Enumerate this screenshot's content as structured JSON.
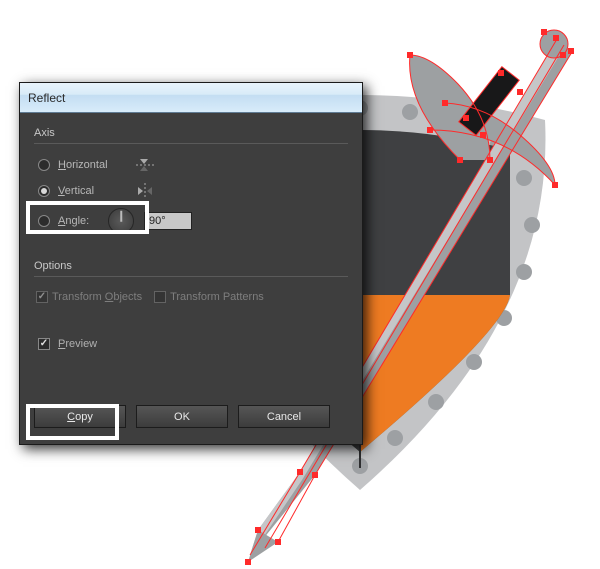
{
  "dialog": {
    "title": "Reflect",
    "axis": {
      "label": "Axis",
      "horizontal": {
        "label": "Horizontal",
        "checked": false
      },
      "vertical": {
        "label": "Vertical",
        "checked": true
      },
      "angle": {
        "label": "Angle:",
        "checked": false,
        "value": "90°"
      }
    },
    "options": {
      "label": "Options",
      "transform_objects": {
        "label": "Transform Objects",
        "checked": true,
        "disabled": true
      },
      "transform_patterns": {
        "label": "Transform Patterns",
        "checked": false,
        "disabled": true
      }
    },
    "preview": {
      "label": "Preview",
      "checked": true
    },
    "buttons": {
      "copy": "Copy",
      "ok": "OK",
      "cancel": "Cancel"
    }
  }
}
